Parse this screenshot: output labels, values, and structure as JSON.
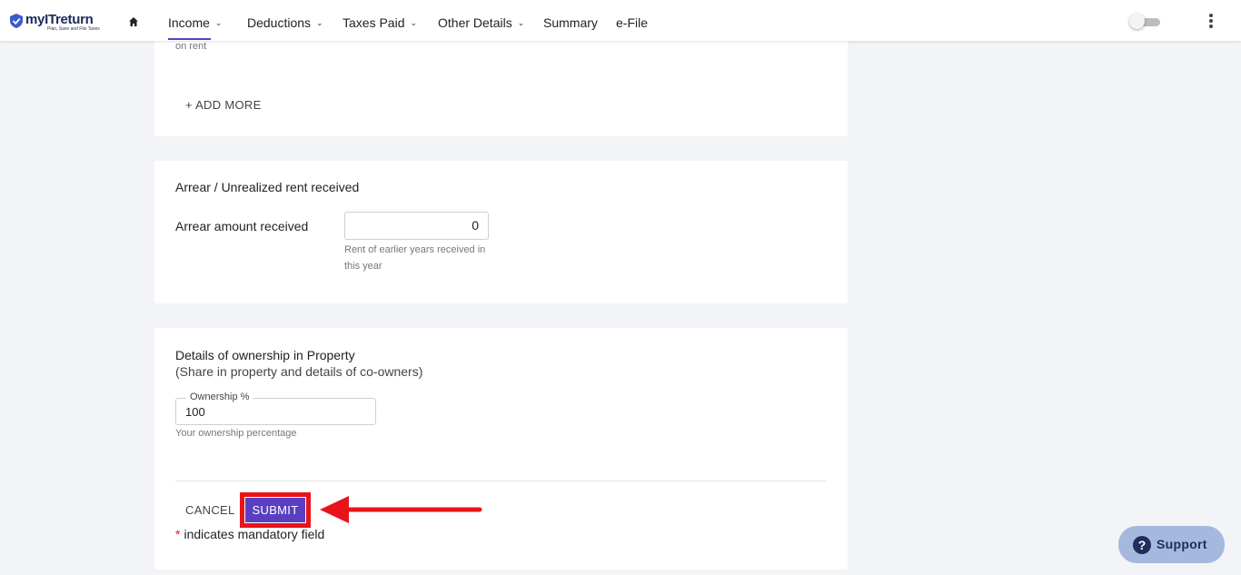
{
  "brand": {
    "name": "myITreturn",
    "tagline": "Plan, Save and File Taxes",
    "accent_color": "#5b3fc2",
    "highlight_color": "#e8141a"
  },
  "nav": {
    "home_icon": "home-icon",
    "items": [
      {
        "label": "Income",
        "active": true,
        "has_dropdown": true
      },
      {
        "label": "Deductions",
        "has_dropdown": true
      },
      {
        "label": "Taxes Paid",
        "has_dropdown": true
      },
      {
        "label": "Other Details",
        "has_dropdown": true
      },
      {
        "label": "Summary",
        "has_dropdown": false
      },
      {
        "label": "e-File",
        "has_dropdown": false
      }
    ],
    "chevron": "⌄",
    "toggle_on": false,
    "menu_icon": "more-vert-icon"
  },
  "rent_section": {
    "helper_text": "on rent",
    "add_more_label": "+ ADD MORE"
  },
  "arrear_section": {
    "title": "Arrear / Unrealized rent received",
    "field_label": "Arrear amount received",
    "field_value": "0",
    "field_help": "Rent of earlier years received in this year"
  },
  "ownership_section": {
    "title": "Details of ownership in Property",
    "subtitle": "(Share in property and details of co-owners)",
    "field_legend": "Ownership %",
    "field_value": "100",
    "field_help": "Your ownership percentage",
    "cancel_label": "CANCEL",
    "submit_label": "SUBMIT",
    "mandatory_star": "*",
    "mandatory_text": "indicates mandatory field"
  },
  "support": {
    "label": "Support",
    "icon_glyph": "?"
  }
}
